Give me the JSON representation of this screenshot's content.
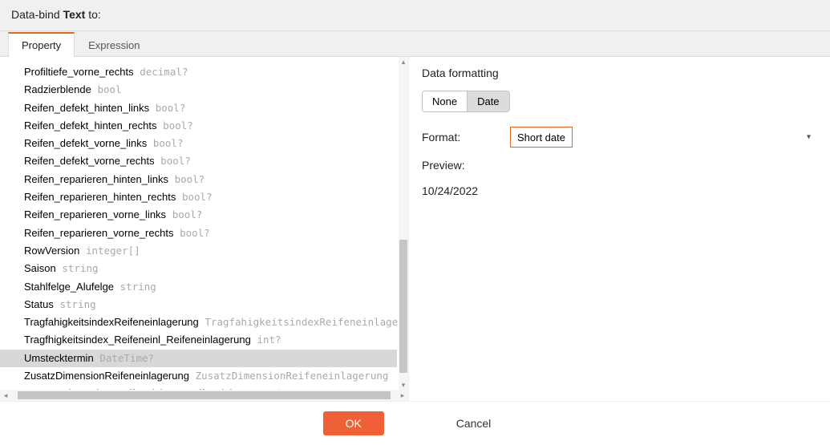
{
  "header": {
    "prefix": "Data-bind ",
    "bold": "Text",
    "suffix": " to:"
  },
  "tabs": [
    {
      "label": "Property",
      "active": true
    },
    {
      "label": "Expression",
      "active": false
    }
  ],
  "properties": [
    {
      "name": "Profiltiefe_vorne_rechts",
      "type": "decimal?",
      "selected": false
    },
    {
      "name": "Radzierblende",
      "type": "bool",
      "selected": false
    },
    {
      "name": "Reifen_defekt_hinten_links",
      "type": "bool?",
      "selected": false
    },
    {
      "name": "Reifen_defekt_hinten_rechts",
      "type": "bool?",
      "selected": false
    },
    {
      "name": "Reifen_defekt_vorne_links",
      "type": "bool?",
      "selected": false
    },
    {
      "name": "Reifen_defekt_vorne_rechts",
      "type": "bool?",
      "selected": false
    },
    {
      "name": "Reifen_reparieren_hinten_links",
      "type": "bool?",
      "selected": false
    },
    {
      "name": "Reifen_reparieren_hinten_rechts",
      "type": "bool?",
      "selected": false
    },
    {
      "name": "Reifen_reparieren_vorne_links",
      "type": "bool?",
      "selected": false
    },
    {
      "name": "Reifen_reparieren_vorne_rechts",
      "type": "bool?",
      "selected": false
    },
    {
      "name": "RowVersion",
      "type": "integer[]",
      "selected": false
    },
    {
      "name": "Saison",
      "type": "string",
      "selected": false
    },
    {
      "name": "Stahlfelge_Alufelge",
      "type": "string",
      "selected": false
    },
    {
      "name": "Status",
      "type": "string",
      "selected": false
    },
    {
      "name": "TragfahigkeitsindexReifeneinlagerung",
      "type": "TragfahigkeitsindexReifeneinlagerung",
      "selected": false
    },
    {
      "name": "Tragfhigkeitsindex_Reifeneinl_Reifeneinlagerung",
      "type": "int?",
      "selected": false
    },
    {
      "name": "Umstecktermin",
      "type": "DateTime?",
      "selected": true
    },
    {
      "name": "ZusatzDimensionReifeneinlagerung",
      "type": "ZusatzDimensionReifeneinlagerung",
      "selected": false
    },
    {
      "name": "Zusatz_Dimension_Reifeneinlage_Reifeneinlagerung",
      "type": "int?",
      "selected": false
    }
  ],
  "right": {
    "title": "Data formatting",
    "mode_buttons": [
      {
        "label": "None",
        "active": false
      },
      {
        "label": "Date",
        "active": true
      }
    ],
    "format_label": "Format:",
    "format_value": "Short date",
    "preview_label": "Preview:",
    "preview_value": "10/24/2022"
  },
  "footer": {
    "ok": "OK",
    "cancel": "Cancel"
  },
  "colors": {
    "accent": "#e8641b",
    "primary_button": "#ef6036"
  }
}
